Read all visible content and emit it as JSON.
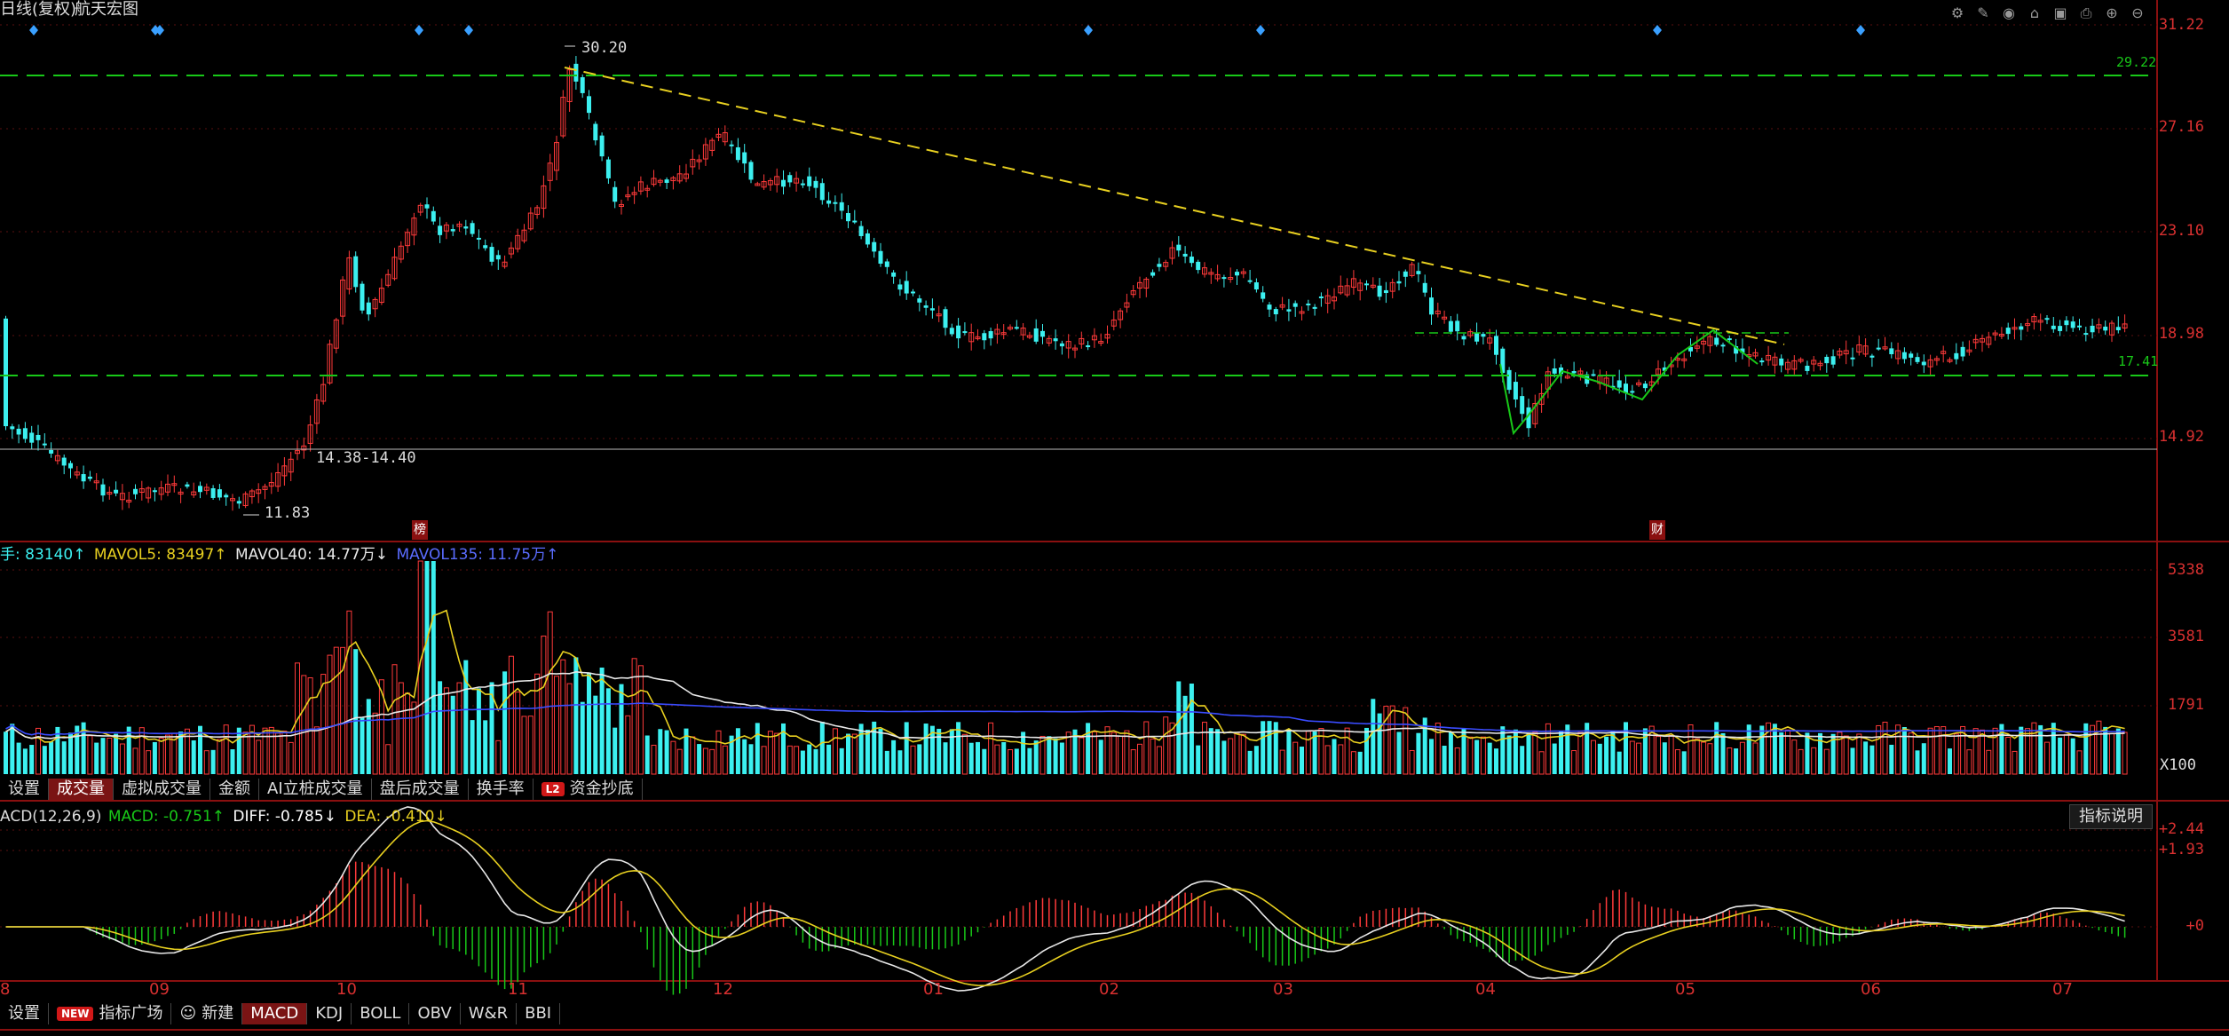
{
  "header": {
    "title_left": "日线(复权)",
    "stock_name": "航天宏图"
  },
  "colors": {
    "up": "#ff3a3a",
    "down": "#3cf0f0",
    "ma_yellow": "#e8d020",
    "ma_white": "#e8e8e8",
    "ma_blue": "#3a4cff",
    "support_green": "#18c818",
    "axis_red": "#d83030"
  },
  "toolbar_icons": [
    "settings-icon",
    "pen-icon",
    "eye-icon",
    "home-icon",
    "lock-icon",
    "print-icon",
    "zoom-in-icon",
    "zoom-out-icon"
  ],
  "price_axis": [
    "31.22",
    "27.16",
    "23.10",
    "18.98",
    "14.92"
  ],
  "price_levels": {
    "upper_line": "29.22",
    "lower_line": "17.41"
  },
  "annotations": {
    "high": "30.20",
    "low": "11.83",
    "range": "14.38-14.40",
    "marker_bang": "榜",
    "marker_cai": "财"
  },
  "volume": {
    "label_prefix": "手: ",
    "vol": "83140↑",
    "mavol5_label": "MAVOL5: ",
    "mavol5": "83497↑",
    "mavol40_label": "MAVOL40: ",
    "mavol40": "14.77万↓",
    "mavol135_label": "MAVOL135: ",
    "mavol135": "11.75万↑",
    "axis": [
      "5338",
      "3581",
      "1791"
    ],
    "unit": "X100"
  },
  "volume_tabs": [
    {
      "label": "设置"
    },
    {
      "label": "成交量",
      "active": true
    },
    {
      "label": "虚拟成交量"
    },
    {
      "label": "金额"
    },
    {
      "label": "AI立桩成交量"
    },
    {
      "label": "盘后成交量"
    },
    {
      "label": "换手率"
    },
    {
      "label": "资金抄底",
      "badge": "L2"
    }
  ],
  "macd": {
    "name": "ACD(12,26,9)",
    "macd_label": "MACD: ",
    "macd": "-0.751↑",
    "diff_label": "DIFF: ",
    "diff": "-0.785↓",
    "dea_label": "DEA: ",
    "dea": "-0.410↓",
    "axis": [
      "+2.44",
      "+1.93",
      "+0"
    ],
    "explain_button": "指标说明"
  },
  "months": [
    "8",
    "09",
    "10",
    "11",
    "12",
    "01",
    "02",
    "03",
    "04",
    "05",
    "06",
    "07"
  ],
  "indicator_tabs": [
    {
      "label": "设置"
    },
    {
      "label": "指标广场",
      "badge": "NEW"
    },
    {
      "label": "新建",
      "icon": "robot-icon"
    },
    {
      "label": "MACD",
      "active": true
    },
    {
      "label": "KDJ"
    },
    {
      "label": "BOLL"
    },
    {
      "label": "OBV"
    },
    {
      "label": "W&R"
    },
    {
      "label": "BBI"
    }
  ]
}
